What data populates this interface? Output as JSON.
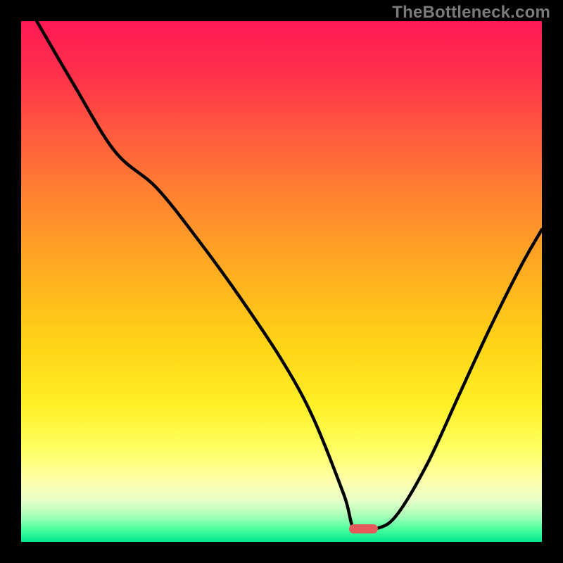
{
  "watermark": "TheBottleneck.com",
  "colors": {
    "frame_bg": "#000000",
    "curve_stroke": "#000000",
    "marker_fill": "#e65a5c"
  },
  "gradient_stops": [
    {
      "offset": 0.0,
      "color": "#ff1954"
    },
    {
      "offset": 0.1,
      "color": "#ff2f4b"
    },
    {
      "offset": 0.22,
      "color": "#ff5c3d"
    },
    {
      "offset": 0.36,
      "color": "#ff8a2e"
    },
    {
      "offset": 0.5,
      "color": "#ffb21e"
    },
    {
      "offset": 0.62,
      "color": "#ffd416"
    },
    {
      "offset": 0.74,
      "color": "#fff028"
    },
    {
      "offset": 0.82,
      "color": "#ffff60"
    },
    {
      "offset": 0.88,
      "color": "#ffffa8"
    },
    {
      "offset": 0.92,
      "color": "#e8ffc8"
    },
    {
      "offset": 0.95,
      "color": "#a8ffb8"
    },
    {
      "offset": 0.975,
      "color": "#4dffa0"
    },
    {
      "offset": 1.0,
      "color": "#00e890"
    }
  ],
  "marker": {
    "x_frac": 0.657,
    "y_frac": 0.975,
    "w_frac": 0.055,
    "h_frac": 0.018
  },
  "chart_data": {
    "type": "line",
    "title": "",
    "xlabel": "",
    "ylabel": "",
    "xlim": [
      0,
      100
    ],
    "ylim": [
      0,
      100
    ],
    "annotations": [
      "TheBottleneck.com"
    ],
    "series": [
      {
        "name": "bottleneck_curve",
        "x": [
          3,
          10,
          18,
          26,
          34,
          42,
          50,
          56,
          62,
          64,
          68,
          72,
          78,
          84,
          90,
          96,
          100
        ],
        "y": [
          100,
          88,
          75,
          68,
          58,
          47,
          35,
          24,
          9,
          2.5,
          2.5,
          5,
          15,
          28,
          41,
          53,
          60
        ]
      }
    ],
    "marker_region": {
      "x_start": 63,
      "x_end": 68.5,
      "y": 2.5
    }
  }
}
